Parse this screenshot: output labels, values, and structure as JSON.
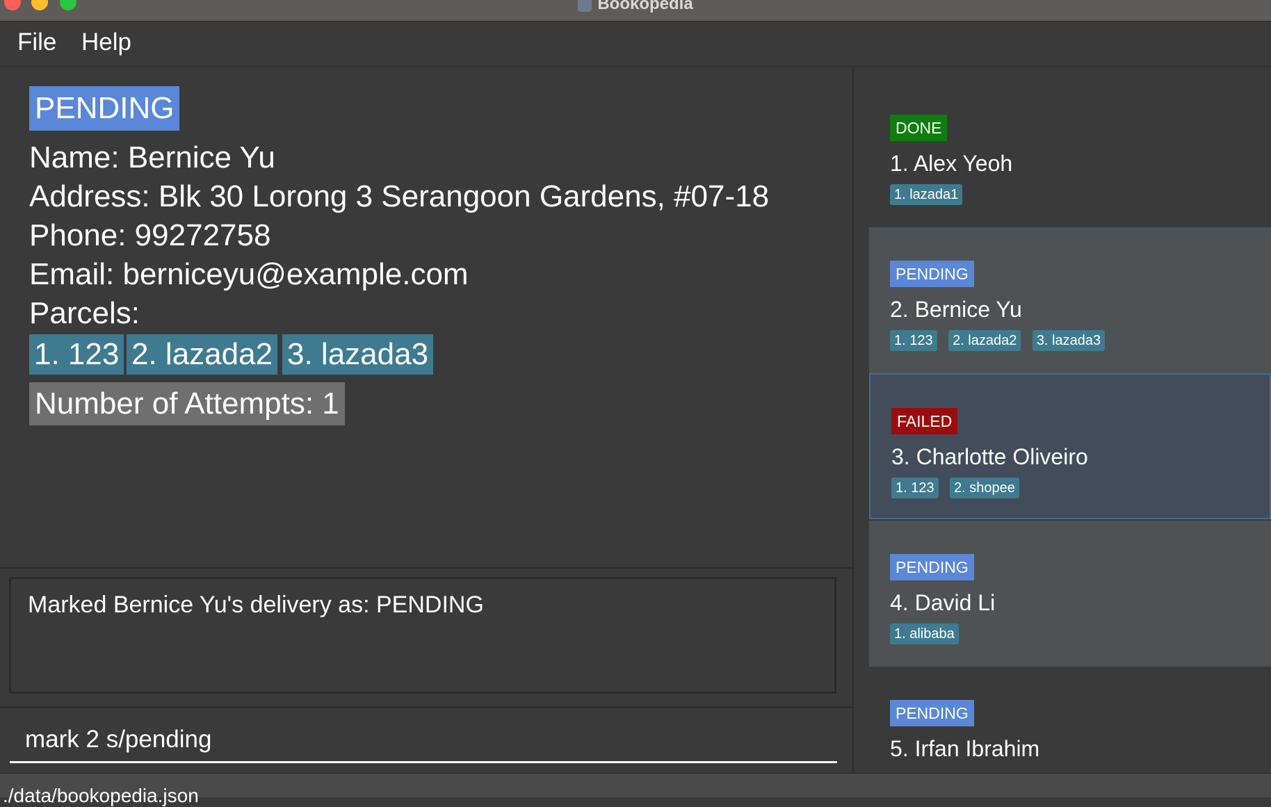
{
  "window": {
    "title": "Bookopedia"
  },
  "menu": {
    "file": "File",
    "help": "Help"
  },
  "details": {
    "status": "PENDING",
    "name_line": "Name: Bernice Yu",
    "address_line": "Address: Blk 30 Lorong 3 Serangoon Gardens, #07-18",
    "phone_line": "Phone: 99272758",
    "email_line": "Email: berniceyu@example.com",
    "parcels_label": "Parcels:",
    "parcels": [
      "1. 123",
      "2. lazada2",
      "3. lazada3"
    ],
    "attempts": "Number of Attempts: 1"
  },
  "result": {
    "text": "Marked Bernice Yu's delivery as: PENDING"
  },
  "command": {
    "value": "mark 2 s/pending"
  },
  "statusbar": {
    "path": "./data/bookopedia.json"
  },
  "colors": {
    "pending": "#5b87d8",
    "done": "#0f7d0f",
    "failed": "#9b0d0d",
    "tag": "#3e7b91"
  },
  "list": {
    "items": [
      {
        "status": "DONE",
        "name": "1.  Alex Yeoh",
        "tags": [
          "1. lazada1"
        ]
      },
      {
        "status": "PENDING",
        "name": "2.  Bernice Yu",
        "tags": [
          "1. 123",
          "2. lazada2",
          "3. lazada3"
        ]
      },
      {
        "status": "FAILED",
        "name": "3.  Charlotte Oliveiro",
        "tags": [
          "1. 123",
          "2. shopee"
        ]
      },
      {
        "status": "PENDING",
        "name": "4.  David Li",
        "tags": [
          "1. alibaba"
        ]
      },
      {
        "status": "PENDING",
        "name": "5.  Irfan Ibrahim",
        "tags": []
      }
    ]
  }
}
